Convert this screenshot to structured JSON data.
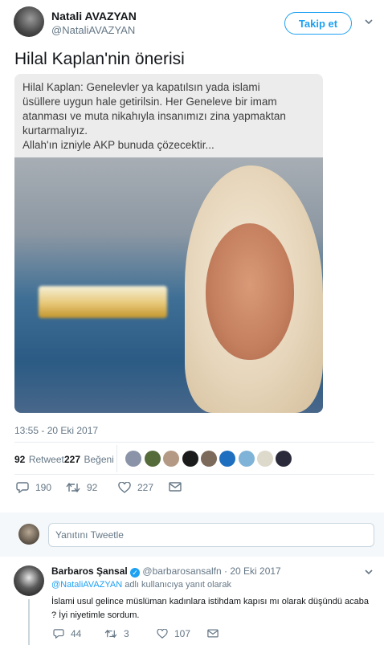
{
  "tweet": {
    "author_name": "Natali AVAZYAN",
    "author_handle": "@NataliAVAZYAN",
    "follow_label": "Takip et",
    "text": "Hilal Kaplan'nin önerisi",
    "media_text_lines": [
      "Hilal Kaplan: Genelevler ya kapatılsın yada islami",
      "üsüllere uygun hale getirilsin. Her Geneleve bir imam",
      "atanması ve muta nikahıyla insanımızı zina yapmaktan",
      "kurtarmalıyız.",
      "Allah'ın izniyle AKP bunuda çözecektir..."
    ],
    "timestamp": "13:55 - 20 Eki 2017",
    "retweets_count": "92",
    "retweets_label": "Retweet",
    "likes_count": "227",
    "likes_label": "Beğeni",
    "actions": {
      "reply_count": "190",
      "retweet_count": "92",
      "like_count": "227"
    }
  },
  "reply_compose": {
    "placeholder": "Yanıtını Tweetle"
  },
  "reply": {
    "author_name": "Barbaros Şansal",
    "author_handle": "@barbarosansalfn",
    "date": "· 20 Eki 2017",
    "replying_to_handle": "@NataliAVAZYAN",
    "replying_to_suffix": "adlı kullanıcıya yanıt olarak",
    "text_line1": "İslami usul gelince müslüman kadınlara istihdam kapısı mı olarak düşündü acaba",
    "text_line2": "? İyi niyetimle sordum.",
    "actions": {
      "reply_count": "44",
      "retweet_count": "3",
      "like_count": "107"
    }
  },
  "colors": {
    "accent": "#1da1f2",
    "secondary_text": "#657786",
    "divider": "#e6ecf0"
  },
  "icons": [
    "avatar",
    "caret-down-icon",
    "reply-icon",
    "retweet-icon",
    "like-icon",
    "dm-icon",
    "verified-icon"
  ]
}
